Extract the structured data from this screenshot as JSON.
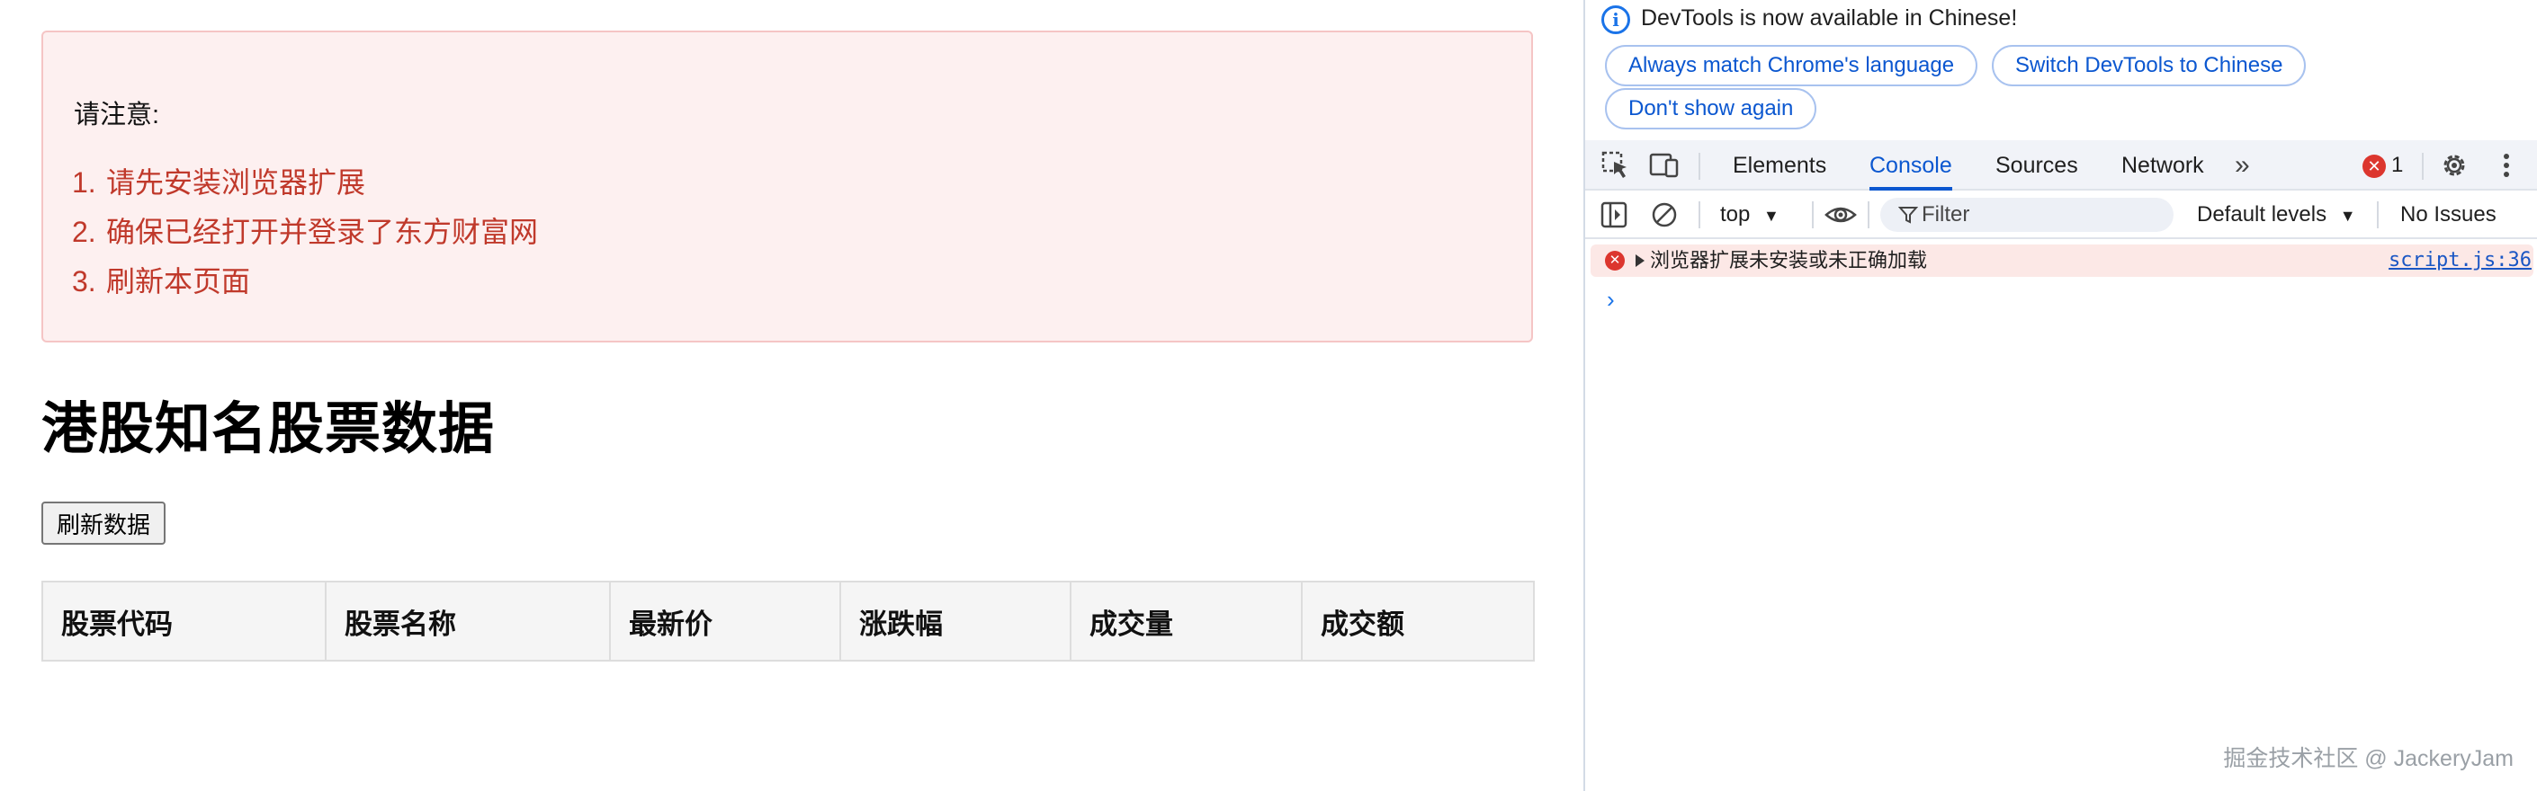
{
  "notice": {
    "title": "请注意:",
    "items": [
      {
        "num": "1.",
        "text": "请先安装浏览器扩展"
      },
      {
        "num": "2.",
        "text": "确保已经打开并登录了东方财富网"
      },
      {
        "num": "3.",
        "text": "刷新本页面"
      }
    ]
  },
  "page": {
    "title": "港股知名股票数据",
    "refresh_label": "刷新数据"
  },
  "table": {
    "headers": [
      "股票代码",
      "股票名称",
      "最新价",
      "涨跌幅",
      "成交量",
      "成交额"
    ]
  },
  "devtools": {
    "infobar": {
      "message": "DevTools is now available in Chinese!",
      "btn_match": "Always match Chrome's language",
      "btn_switch": "Switch DevTools to Chinese",
      "btn_dismiss": "Don't show again"
    },
    "tabs": [
      "Elements",
      "Console",
      "Sources",
      "Network"
    ],
    "active_tab": "Console",
    "error_count": "1",
    "toolbar": {
      "context": "top",
      "filter_placeholder": "Filter",
      "levels": "Default levels",
      "issues": "No Issues"
    },
    "console": {
      "message": "浏览器扩展未安装或未正确加载",
      "source": "script.js:36",
      "prompt": "›"
    }
  },
  "watermark": "掘金技术社区 @ JackeryJam",
  "colors": {
    "notice_bg": "#fdf0f0",
    "notice_border": "#f5c5c5",
    "notice_text": "#c0392b",
    "devtools_accent": "#0b57d0",
    "error_red": "#dc362e",
    "error_row_bg": "#fce8e6"
  },
  "icons": [
    "info-icon",
    "inspect-element-icon",
    "device-toggle-icon",
    "more-tabs-icon",
    "error-icon",
    "gear-icon",
    "kebab-menu-icon",
    "sidebar-icon",
    "clear-icon",
    "dropdown-caret-icon",
    "eye-icon",
    "filter-icon",
    "expand-triangle-icon"
  ]
}
